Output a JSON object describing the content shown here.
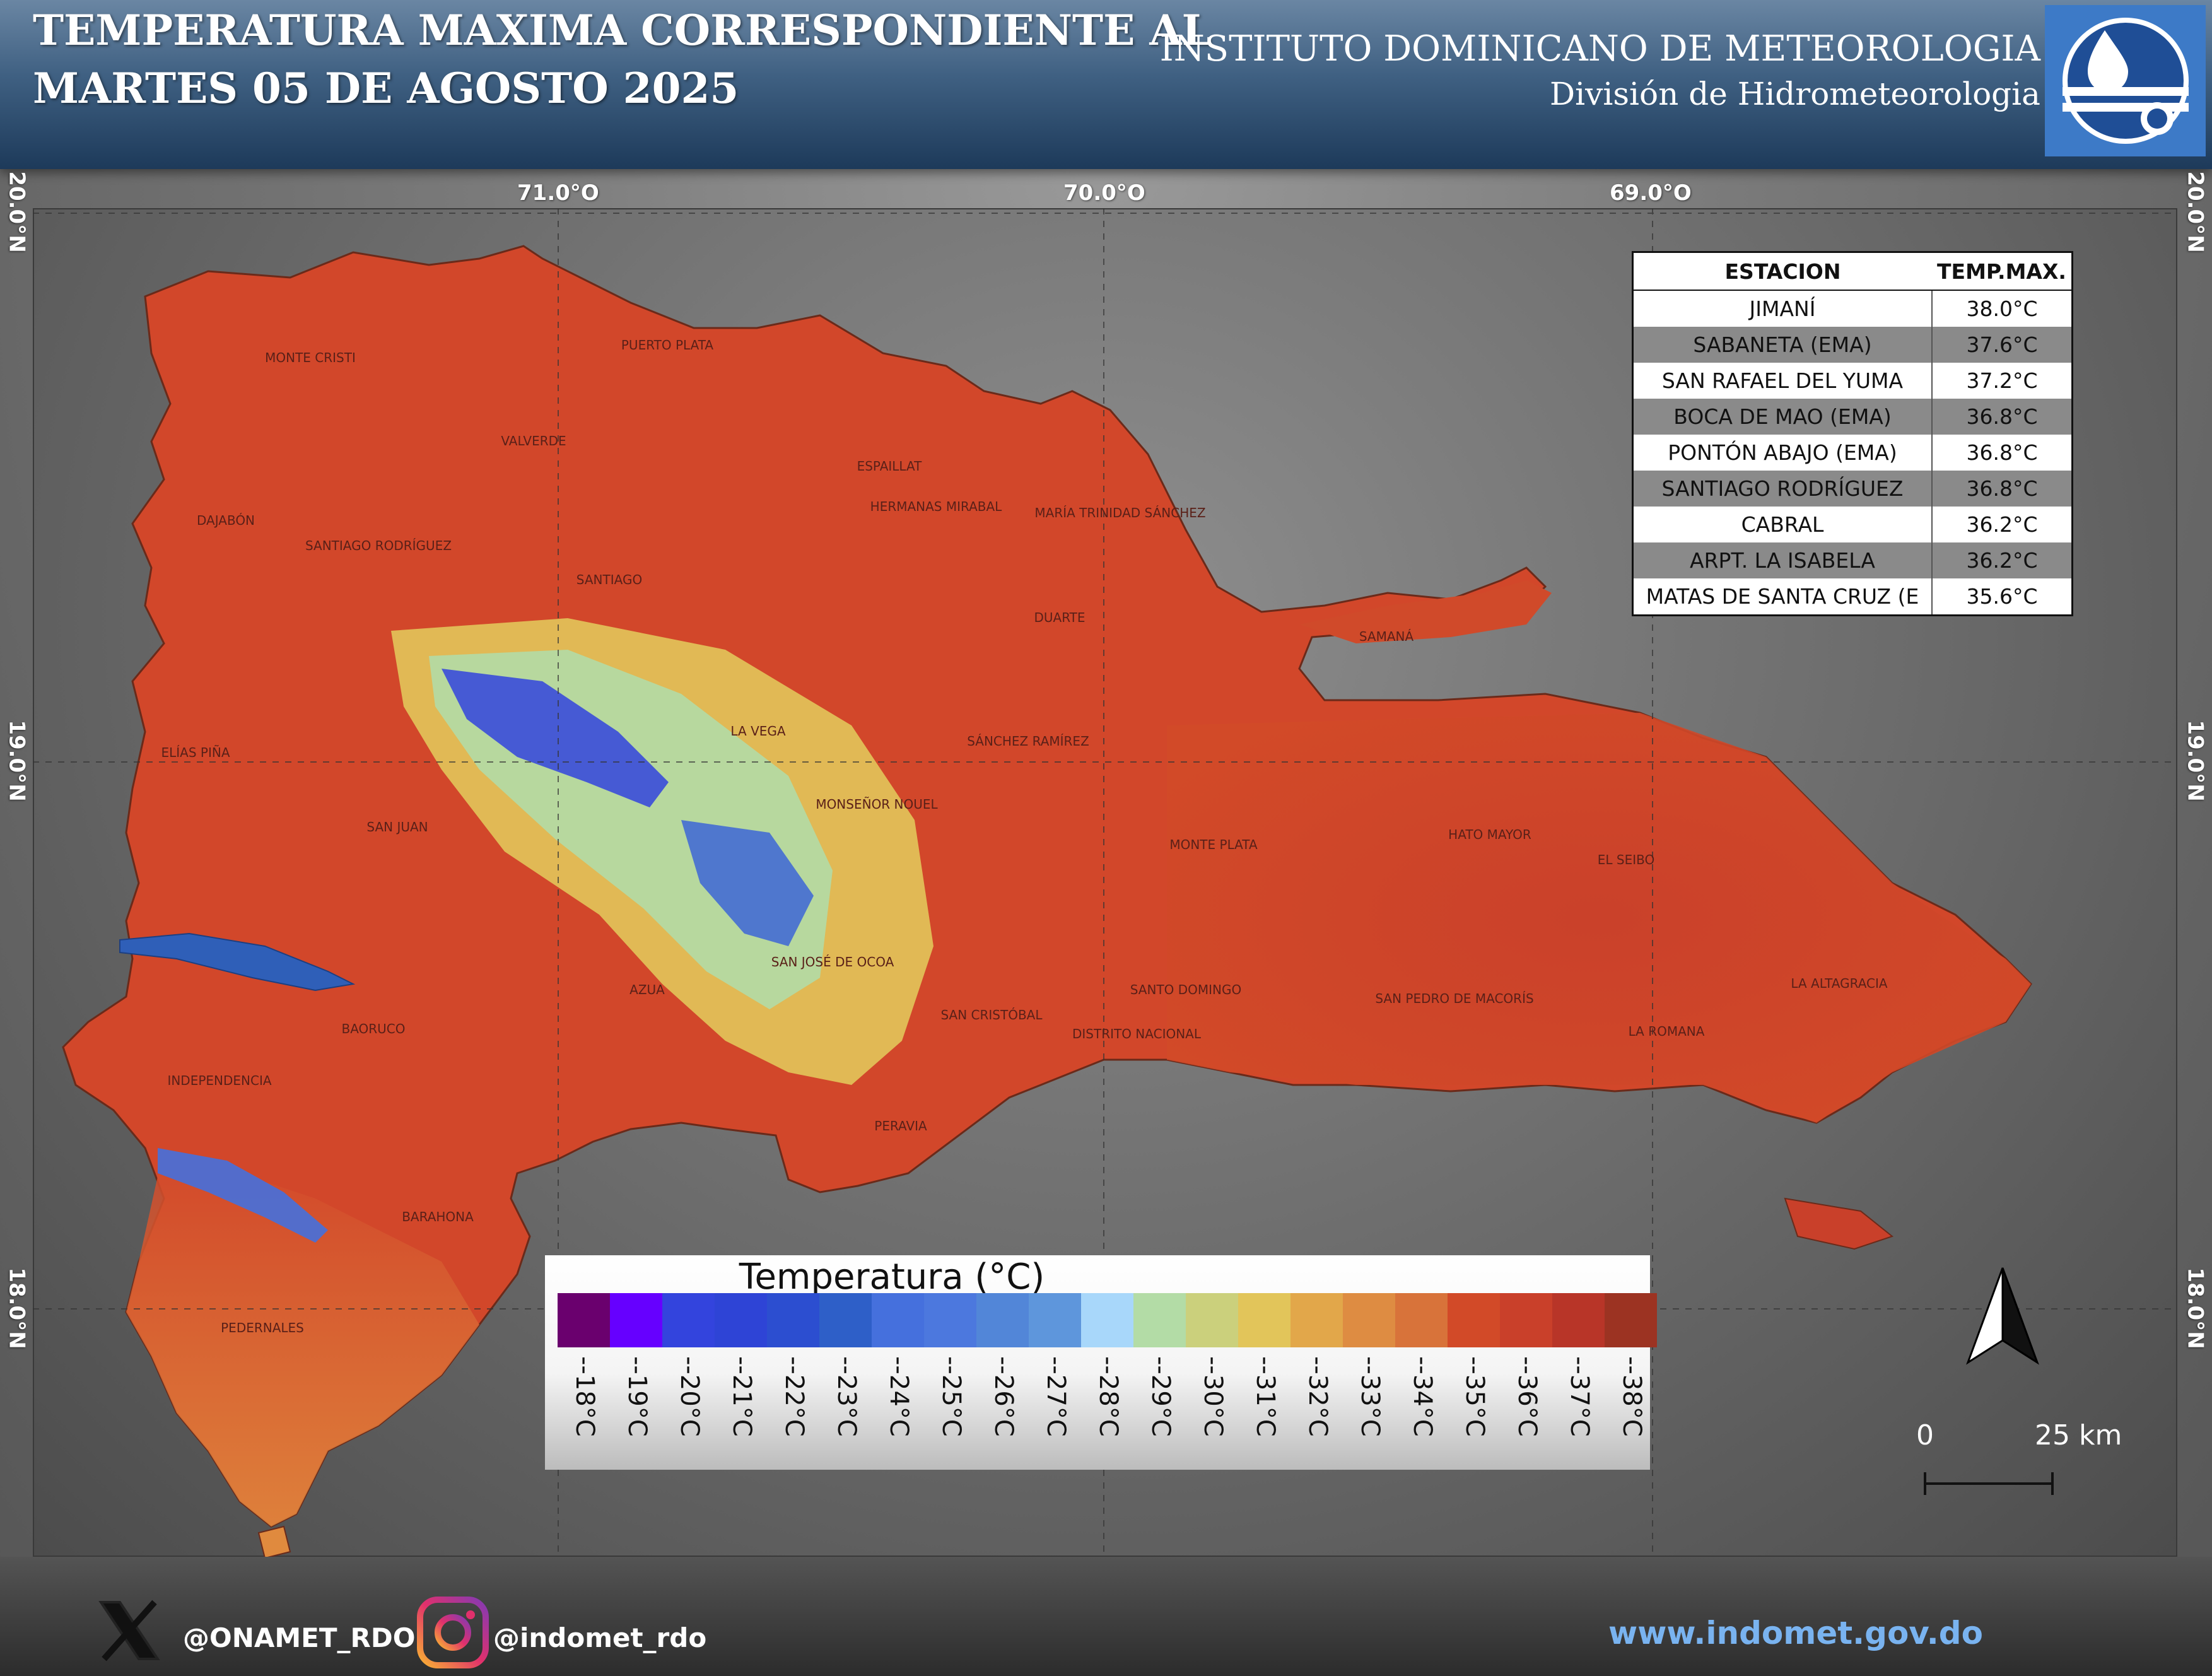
{
  "header": {
    "title_line1": "TEMPERATURA MAXIMA CORRESPONDIENTE AL",
    "title_line2": "MARTES 05 DE AGOSTO 2025",
    "org_line1": "INSTITUTO DOMINICANO DE METEOROLOGIA",
    "org_line2": "División de Hidrometeorologia"
  },
  "coords": {
    "lon_1": "71.0°O",
    "lon_2": "70.0°O",
    "lon_3": "69.0°O",
    "lat_1": "20.0°N",
    "lat_2": "19.0°N",
    "lat_3": "18.0°N"
  },
  "table": {
    "header_station": "ESTACION",
    "header_temp": "TEMP.MAX.",
    "rows": [
      {
        "station": "JIMANÍ",
        "temp": "38.0°C"
      },
      {
        "station": "SABANETA (EMA)",
        "temp": "37.6°C"
      },
      {
        "station": "SAN RAFAEL DEL YUMA",
        "temp": "37.2°C"
      },
      {
        "station": "BOCA DE MAO (EMA)",
        "temp": "36.8°C"
      },
      {
        "station": "PONTÓN ABAJO (EMA)",
        "temp": "36.8°C"
      },
      {
        "station": "SANTIAGO RODRÍGUEZ",
        "temp": "36.8°C"
      },
      {
        "station": "CABRAL",
        "temp": "36.2°C"
      },
      {
        "station": "ARPT. LA ISABELA",
        "temp": "36.2°C"
      },
      {
        "station": "MATAS DE SANTA CRUZ (E",
        "temp": "35.6°C"
      }
    ]
  },
  "provinces": [
    {
      "name": "MONTE CRISTI"
    },
    {
      "name": "PUERTO PLATA"
    },
    {
      "name": "VALVERDE"
    },
    {
      "name": "ESPAILLAT"
    },
    {
      "name": "HERMANAS MIRABAL"
    },
    {
      "name": "MARÍA TRINIDAD SÁNCHEZ"
    },
    {
      "name": "DAJABÓN"
    },
    {
      "name": "SANTIAGO RODRÍGUEZ"
    },
    {
      "name": "SANTIAGO"
    },
    {
      "name": "DUARTE"
    },
    {
      "name": "SAMANÁ"
    },
    {
      "name": "LA VEGA"
    },
    {
      "name": "SÁNCHEZ RAMÍREZ"
    },
    {
      "name": "ELÍAS PIÑA"
    },
    {
      "name": "MONSEÑOR NOUEL"
    },
    {
      "name": "SAN JUAN"
    },
    {
      "name": "MONTE PLATA"
    },
    {
      "name": "HATO MAYOR"
    },
    {
      "name": "EL SEIBO"
    },
    {
      "name": "SAN JOSÉ DE OCOA"
    },
    {
      "name": "AZUA"
    },
    {
      "name": "SANTO DOMINGO"
    },
    {
      "name": "SAN PEDRO DE MACORÍS"
    },
    {
      "name": "LA ALTAGRACIA"
    },
    {
      "name": "BAORUCO"
    },
    {
      "name": "SAN CRISTÓBAL"
    },
    {
      "name": "DISTRITO NACIONAL"
    },
    {
      "name": "LA ROMANA"
    },
    {
      "name": "INDEPENDENCIA"
    },
    {
      "name": "PERAVIA"
    },
    {
      "name": "BARAHONA"
    },
    {
      "name": "PEDERNALES"
    }
  ],
  "legend": {
    "title": "Temperatura (°C)",
    "items": [
      {
        "label": "--18°C",
        "color": "#6a006e"
      },
      {
        "label": "--19°C",
        "color": "#6600ff"
      },
      {
        "label": "--20°C",
        "color": "#3344dd"
      },
      {
        "label": "--21°C",
        "color": "#2e44d6"
      },
      {
        "label": "--22°C",
        "color": "#2c4ed0"
      },
      {
        "label": "--23°C",
        "color": "#2e5fc8"
      },
      {
        "label": "--24°C",
        "color": "#4570dd"
      },
      {
        "label": "--25°C",
        "color": "#4c78de"
      },
      {
        "label": "--26°C",
        "color": "#5286d8"
      },
      {
        "label": "--27°C",
        "color": "#5e96dc"
      },
      {
        "label": "--28°C",
        "color": "#a8d7fa"
      },
      {
        "label": "--29°C",
        "color": "#b3dca6"
      },
      {
        "label": "--30°C",
        "color": "#cbd07c"
      },
      {
        "label": "--31°C",
        "color": "#e2c55a"
      },
      {
        "label": "--32°C",
        "color": "#e2a74a"
      },
      {
        "label": "--33°C",
        "color": "#de8c42"
      },
      {
        "label": "--34°C",
        "color": "#d8733a"
      },
      {
        "label": "--35°C",
        "color": "#d24a28"
      },
      {
        "label": "--36°C",
        "color": "#c9402a"
      },
      {
        "label": "--37°C",
        "color": "#b83528"
      },
      {
        "label": "--38°C",
        "color": "#9c3322"
      }
    ]
  },
  "scale": {
    "zero": "0",
    "distance": "25 km"
  },
  "footer": {
    "twitter_handle": "@ONAMET_RDO",
    "instagram_handle": "@indomet_rdo",
    "website": "www.indomet.gov.do"
  }
}
